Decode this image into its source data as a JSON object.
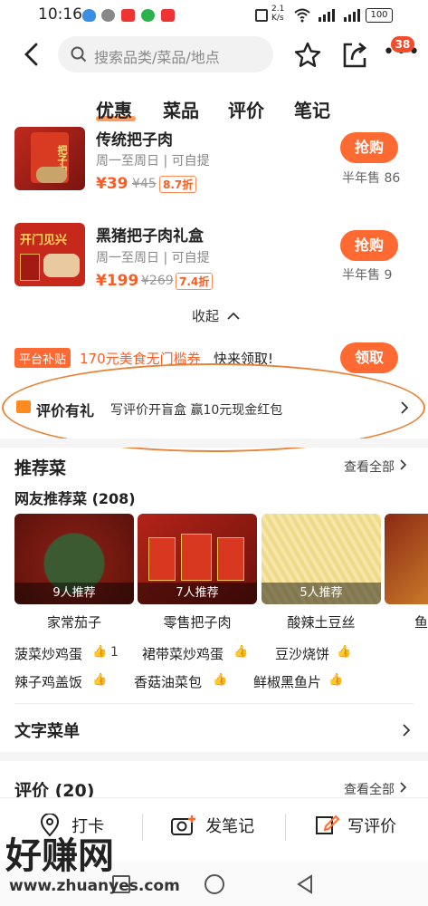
{
  "status": {
    "time": "10:16",
    "speed": "2.1\nK/s",
    "battery": "100"
  },
  "search": {
    "placeholder": "搜索品类/菜品/地点"
  },
  "header": {
    "more_badge": "38"
  },
  "tabs": [
    "优惠",
    "菜品",
    "评价",
    "笔记"
  ],
  "deals": [
    {
      "name": "传统把子肉",
      "sub": "周一至周日 | 可自提",
      "price": "¥39",
      "old_price": "¥45",
      "discount": "8.7折",
      "buy": "抢购",
      "sold": "半年售 86",
      "thumb_text": "把子肉"
    },
    {
      "name": "黑猪把子肉礼盒",
      "sub": "周一至周日 | 可自提",
      "price": "¥199",
      "old_price": "¥269",
      "discount": "7.4折",
      "buy": "抢购",
      "sold": "半年售 9",
      "thumb_text": "开门见兴"
    }
  ],
  "collapse": "收起",
  "subsidy": {
    "tag": "平台补贴",
    "text": "170元美食无门槛券",
    "tail": "快来领取!",
    "claim": "领取"
  },
  "review_gift": {
    "title": "评价有礼",
    "desc": "写评价开盲盒 赢10元现金红包"
  },
  "recommend": {
    "title": "推荐菜",
    "see_all": "查看全部",
    "subtitle": "网友推荐菜 (208)",
    "cards": [
      {
        "count": "9人推荐",
        "name": "家常茄子"
      },
      {
        "count": "7人推荐",
        "name": "零售把子肉"
      },
      {
        "count": "5人推荐",
        "name": "酸辣土豆丝"
      },
      {
        "count": "",
        "name": "鱼"
      }
    ],
    "rows": [
      [
        {
          "name": "菠菜炒鸡蛋",
          "likes": "1"
        },
        {
          "name": "裙带菜炒鸡蛋",
          "likes": ""
        },
        {
          "name": "豆沙烧饼",
          "likes": ""
        }
      ],
      [
        {
          "name": "辣子鸡盖饭",
          "likes": ""
        },
        {
          "name": "香菇油菜包",
          "likes": ""
        },
        {
          "name": "鲜椒黑鱼片",
          "likes": ""
        }
      ]
    ]
  },
  "text_menu": {
    "title": "文字菜单"
  },
  "reviews": {
    "title": "评价 (20)",
    "see_all": "查看全部"
  },
  "bottom": {
    "checkin": "打卡",
    "note": "发笔记",
    "review": "写评价"
  },
  "watermark": {
    "big": "好赚网",
    "url": "www.zhuanyes.com"
  },
  "colors": {
    "accent": "#ff6a33",
    "price": "#ff5a1f"
  }
}
